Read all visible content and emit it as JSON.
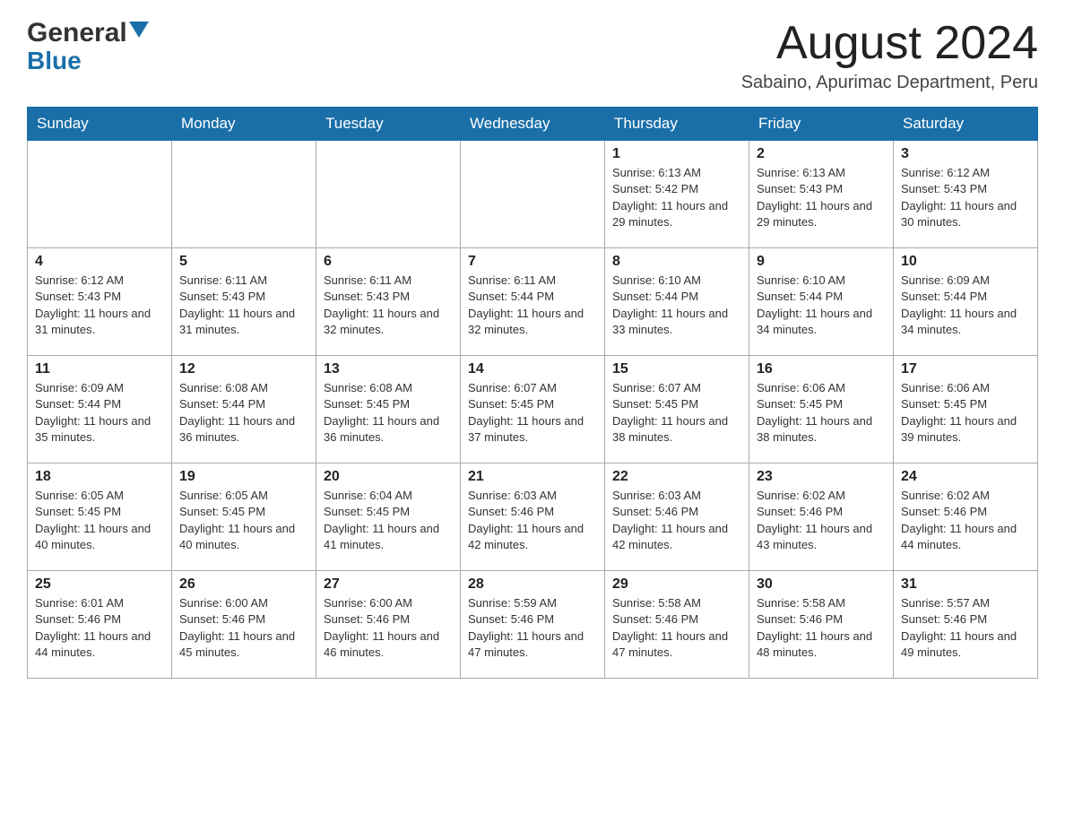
{
  "header": {
    "logo_general": "General",
    "logo_blue": "Blue",
    "month_title": "August 2024",
    "location": "Sabaino, Apurimac Department, Peru"
  },
  "days_of_week": [
    "Sunday",
    "Monday",
    "Tuesday",
    "Wednesday",
    "Thursday",
    "Friday",
    "Saturday"
  ],
  "weeks": [
    [
      {
        "day": "",
        "info": ""
      },
      {
        "day": "",
        "info": ""
      },
      {
        "day": "",
        "info": ""
      },
      {
        "day": "",
        "info": ""
      },
      {
        "day": "1",
        "info": "Sunrise: 6:13 AM\nSunset: 5:42 PM\nDaylight: 11 hours and 29 minutes."
      },
      {
        "day": "2",
        "info": "Sunrise: 6:13 AM\nSunset: 5:43 PM\nDaylight: 11 hours and 29 minutes."
      },
      {
        "day": "3",
        "info": "Sunrise: 6:12 AM\nSunset: 5:43 PM\nDaylight: 11 hours and 30 minutes."
      }
    ],
    [
      {
        "day": "4",
        "info": "Sunrise: 6:12 AM\nSunset: 5:43 PM\nDaylight: 11 hours and 31 minutes."
      },
      {
        "day": "5",
        "info": "Sunrise: 6:11 AM\nSunset: 5:43 PM\nDaylight: 11 hours and 31 minutes."
      },
      {
        "day": "6",
        "info": "Sunrise: 6:11 AM\nSunset: 5:43 PM\nDaylight: 11 hours and 32 minutes."
      },
      {
        "day": "7",
        "info": "Sunrise: 6:11 AM\nSunset: 5:44 PM\nDaylight: 11 hours and 32 minutes."
      },
      {
        "day": "8",
        "info": "Sunrise: 6:10 AM\nSunset: 5:44 PM\nDaylight: 11 hours and 33 minutes."
      },
      {
        "day": "9",
        "info": "Sunrise: 6:10 AM\nSunset: 5:44 PM\nDaylight: 11 hours and 34 minutes."
      },
      {
        "day": "10",
        "info": "Sunrise: 6:09 AM\nSunset: 5:44 PM\nDaylight: 11 hours and 34 minutes."
      }
    ],
    [
      {
        "day": "11",
        "info": "Sunrise: 6:09 AM\nSunset: 5:44 PM\nDaylight: 11 hours and 35 minutes."
      },
      {
        "day": "12",
        "info": "Sunrise: 6:08 AM\nSunset: 5:44 PM\nDaylight: 11 hours and 36 minutes."
      },
      {
        "day": "13",
        "info": "Sunrise: 6:08 AM\nSunset: 5:45 PM\nDaylight: 11 hours and 36 minutes."
      },
      {
        "day": "14",
        "info": "Sunrise: 6:07 AM\nSunset: 5:45 PM\nDaylight: 11 hours and 37 minutes."
      },
      {
        "day": "15",
        "info": "Sunrise: 6:07 AM\nSunset: 5:45 PM\nDaylight: 11 hours and 38 minutes."
      },
      {
        "day": "16",
        "info": "Sunrise: 6:06 AM\nSunset: 5:45 PM\nDaylight: 11 hours and 38 minutes."
      },
      {
        "day": "17",
        "info": "Sunrise: 6:06 AM\nSunset: 5:45 PM\nDaylight: 11 hours and 39 minutes."
      }
    ],
    [
      {
        "day": "18",
        "info": "Sunrise: 6:05 AM\nSunset: 5:45 PM\nDaylight: 11 hours and 40 minutes."
      },
      {
        "day": "19",
        "info": "Sunrise: 6:05 AM\nSunset: 5:45 PM\nDaylight: 11 hours and 40 minutes."
      },
      {
        "day": "20",
        "info": "Sunrise: 6:04 AM\nSunset: 5:45 PM\nDaylight: 11 hours and 41 minutes."
      },
      {
        "day": "21",
        "info": "Sunrise: 6:03 AM\nSunset: 5:46 PM\nDaylight: 11 hours and 42 minutes."
      },
      {
        "day": "22",
        "info": "Sunrise: 6:03 AM\nSunset: 5:46 PM\nDaylight: 11 hours and 42 minutes."
      },
      {
        "day": "23",
        "info": "Sunrise: 6:02 AM\nSunset: 5:46 PM\nDaylight: 11 hours and 43 minutes."
      },
      {
        "day": "24",
        "info": "Sunrise: 6:02 AM\nSunset: 5:46 PM\nDaylight: 11 hours and 44 minutes."
      }
    ],
    [
      {
        "day": "25",
        "info": "Sunrise: 6:01 AM\nSunset: 5:46 PM\nDaylight: 11 hours and 44 minutes."
      },
      {
        "day": "26",
        "info": "Sunrise: 6:00 AM\nSunset: 5:46 PM\nDaylight: 11 hours and 45 minutes."
      },
      {
        "day": "27",
        "info": "Sunrise: 6:00 AM\nSunset: 5:46 PM\nDaylight: 11 hours and 46 minutes."
      },
      {
        "day": "28",
        "info": "Sunrise: 5:59 AM\nSunset: 5:46 PM\nDaylight: 11 hours and 47 minutes."
      },
      {
        "day": "29",
        "info": "Sunrise: 5:58 AM\nSunset: 5:46 PM\nDaylight: 11 hours and 47 minutes."
      },
      {
        "day": "30",
        "info": "Sunrise: 5:58 AM\nSunset: 5:46 PM\nDaylight: 11 hours and 48 minutes."
      },
      {
        "day": "31",
        "info": "Sunrise: 5:57 AM\nSunset: 5:46 PM\nDaylight: 11 hours and 49 minutes."
      }
    ]
  ]
}
